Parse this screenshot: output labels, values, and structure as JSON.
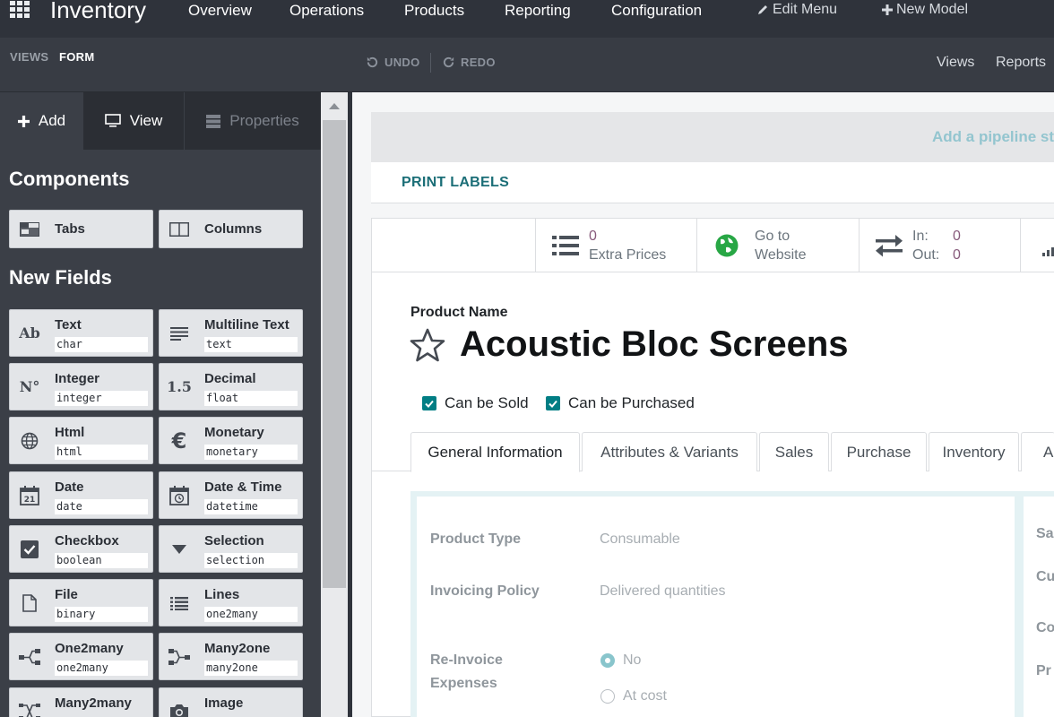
{
  "navbar": {
    "app_name": "Inventory",
    "menus": [
      "Overview",
      "Operations",
      "Products",
      "Reporting",
      "Configuration"
    ],
    "edit_menu": "Edit Menu",
    "new_model": "New Model"
  },
  "studio_bar": {
    "breadcrumb_views": "VIEWS",
    "breadcrumb_form": "FORM",
    "undo": "UNDO",
    "redo": "REDO",
    "views": "Views",
    "reports": "Reports"
  },
  "sidebar": {
    "tabs": {
      "add": "Add",
      "view": "View",
      "properties": "Properties"
    },
    "components_title": "Components",
    "components": [
      {
        "label": "Tabs",
        "icon": "tabs-icon"
      },
      {
        "label": "Columns",
        "icon": "columns-icon"
      }
    ],
    "new_fields_title": "New Fields",
    "fields": [
      {
        "label": "Text",
        "type": "char",
        "icon": "text-ab-icon"
      },
      {
        "label": "Multiline Text",
        "type": "text",
        "icon": "align-left-icon"
      },
      {
        "label": "Integer",
        "type": "integer",
        "icon": "numero-icon"
      },
      {
        "label": "Decimal",
        "type": "float",
        "icon": "decimal-icon"
      },
      {
        "label": "Html",
        "type": "html",
        "icon": "globe-icon"
      },
      {
        "label": "Monetary",
        "type": "monetary",
        "icon": "euro-icon"
      },
      {
        "label": "Date",
        "type": "date",
        "icon": "calendar-icon"
      },
      {
        "label": "Date & Time",
        "type": "datetime",
        "icon": "calendar-clock-icon"
      },
      {
        "label": "Checkbox",
        "type": "boolean",
        "icon": "checkbox-icon"
      },
      {
        "label": "Selection",
        "type": "selection",
        "icon": "caret-down-icon"
      },
      {
        "label": "File",
        "type": "binary",
        "icon": "file-icon"
      },
      {
        "label": "Lines",
        "type": "one2many",
        "icon": "list-icon"
      },
      {
        "label": "One2many",
        "type": "one2many",
        "icon": "share-icon"
      },
      {
        "label": "Many2one",
        "type": "many2one",
        "icon": "merge-icon"
      },
      {
        "label": "Many2many",
        "type": "",
        "icon": "random-icon"
      },
      {
        "label": "Image",
        "type": "",
        "icon": "camera-icon"
      }
    ]
  },
  "form": {
    "statusbar_link": "Add a pipeline sta",
    "print_labels": "PRINT LABELS",
    "stat_buttons": {
      "extra_prices_value": "0",
      "extra_prices_label": "Extra Prices",
      "website_line1": "Go to",
      "website_line2": "Website",
      "in_label": "In:",
      "in_value": "0",
      "out_label": "Out:",
      "out_value": "0"
    },
    "product_name_label": "Product Name",
    "product_name": "Acoustic Bloc Screens",
    "can_be_sold": "Can be Sold",
    "can_be_purchased": "Can be Purchased",
    "notebook_tabs": [
      "General Information",
      "Attributes & Variants",
      "Sales",
      "Purchase",
      "Inventory",
      "Ac"
    ],
    "general": {
      "product_type_label": "Product Type",
      "product_type_value": "Consumable",
      "invoicing_policy_label": "Invoicing Policy",
      "invoicing_policy_value": "Delivered quantities",
      "reinvoice_label_1": "Re-Invoice",
      "reinvoice_label_2": "Expenses",
      "reinvoice_options": [
        "No",
        "At cost"
      ],
      "right_col_labels": [
        "Sa",
        "Cu",
        "Co",
        "Pr"
      ]
    }
  },
  "colors": {
    "navbar_bg": "#2f333b",
    "sidebar_bg": "#3b3f47",
    "accent_teal": "#017e84",
    "stat_value": "#875a7b"
  }
}
